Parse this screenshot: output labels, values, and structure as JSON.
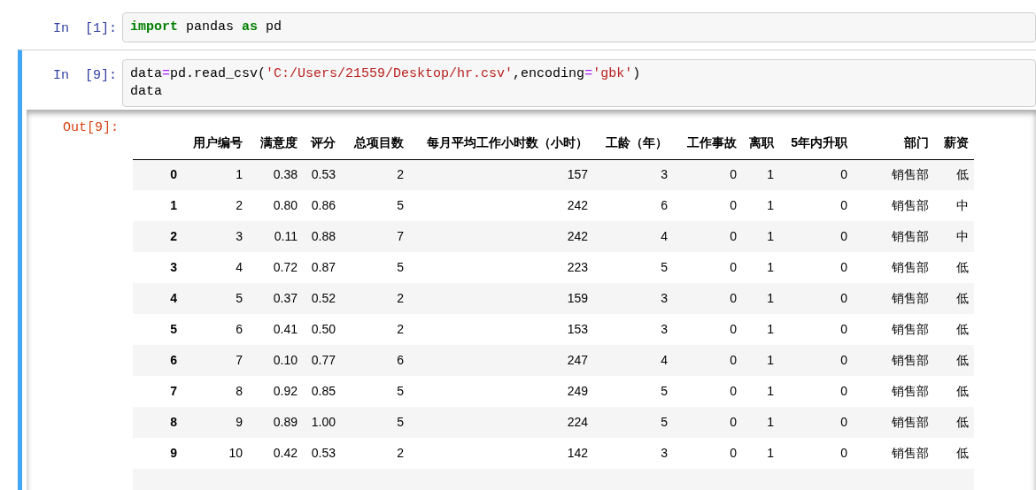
{
  "cells": [
    {
      "selected": false,
      "prompt": "In  [1]:",
      "lines": [
        [
          {
            "kind": "keyword",
            "text": "import"
          },
          {
            "kind": "name",
            "text": " pandas "
          },
          {
            "kind": "keyword",
            "text": "as"
          },
          {
            "kind": "name",
            "text": " pd"
          }
        ]
      ]
    },
    {
      "selected": true,
      "prompt": "In  [9]:",
      "lines": [
        [
          {
            "kind": "name",
            "text": "data"
          },
          {
            "kind": "operator",
            "text": "="
          },
          {
            "kind": "name",
            "text": "pd.read_csv("
          },
          {
            "kind": "string",
            "text": "'C:/Users/21559/Desktop/hr.csv'"
          },
          {
            "kind": "name",
            "text": ",encoding"
          },
          {
            "kind": "operator",
            "text": "="
          },
          {
            "kind": "string",
            "text": "'gbk'"
          },
          {
            "kind": "name",
            "text": ")"
          }
        ],
        [
          {
            "kind": "name",
            "text": "data"
          }
        ]
      ],
      "output": {
        "prompt": "Out[9]:",
        "table": {
          "columns": [
            "用户编号",
            "满意度",
            "评分",
            "总项目数",
            "每月平均工作小时数（小时）",
            "工龄（年）",
            "工作事故",
            "离职",
            "5年内升职",
            "部门",
            "薪资"
          ],
          "rows": [
            {
              "index": "0",
              "cells": [
                "1",
                "0.38",
                "0.53",
                "2",
                "157",
                "3",
                "0",
                "1",
                "0",
                "销售部",
                "低"
              ]
            },
            {
              "index": "1",
              "cells": [
                "2",
                "0.80",
                "0.86",
                "5",
                "242",
                "6",
                "0",
                "1",
                "0",
                "销售部",
                "中"
              ]
            },
            {
              "index": "2",
              "cells": [
                "3",
                "0.11",
                "0.88",
                "7",
                "242",
                "4",
                "0",
                "1",
                "0",
                "销售部",
                "中"
              ]
            },
            {
              "index": "3",
              "cells": [
                "4",
                "0.72",
                "0.87",
                "5",
                "223",
                "5",
                "0",
                "1",
                "0",
                "销售部",
                "低"
              ]
            },
            {
              "index": "4",
              "cells": [
                "5",
                "0.37",
                "0.52",
                "2",
                "159",
                "3",
                "0",
                "1",
                "0",
                "销售部",
                "低"
              ]
            },
            {
              "index": "5",
              "cells": [
                "6",
                "0.41",
                "0.50",
                "2",
                "153",
                "3",
                "0",
                "1",
                "0",
                "销售部",
                "低"
              ]
            },
            {
              "index": "6",
              "cells": [
                "7",
                "0.10",
                "0.77",
                "6",
                "247",
                "4",
                "0",
                "1",
                "0",
                "销售部",
                "低"
              ]
            },
            {
              "index": "7",
              "cells": [
                "8",
                "0.92",
                "0.85",
                "5",
                "249",
                "5",
                "0",
                "1",
                "0",
                "销售部",
                "低"
              ]
            },
            {
              "index": "8",
              "cells": [
                "9",
                "0.89",
                "1.00",
                "5",
                "224",
                "5",
                "0",
                "1",
                "0",
                "销售部",
                "低"
              ]
            },
            {
              "index": "9",
              "cells": [
                "10",
                "0.42",
                "0.53",
                "2",
                "142",
                "3",
                "0",
                "1",
                "0",
                "销售部",
                "低"
              ]
            }
          ]
        }
      }
    }
  ]
}
